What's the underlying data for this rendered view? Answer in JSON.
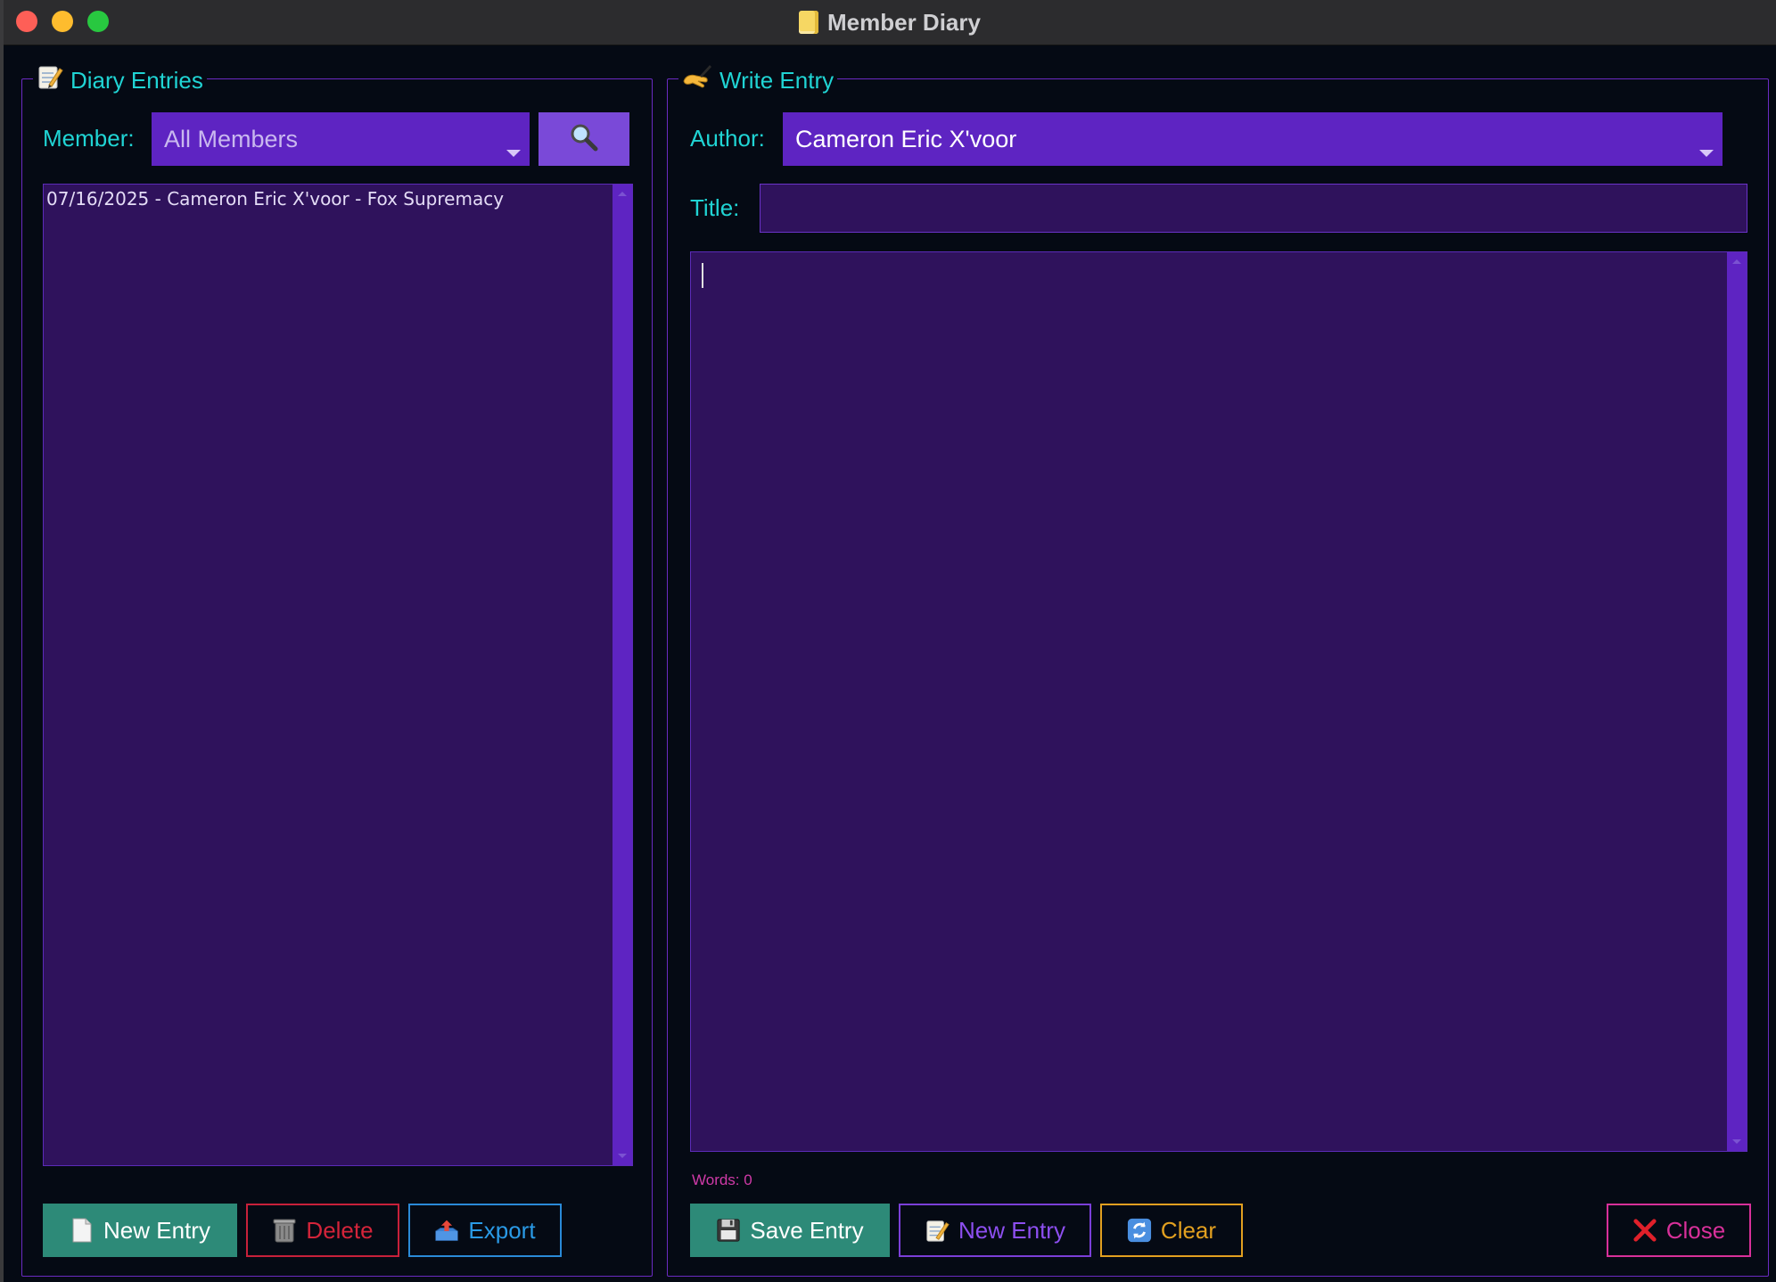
{
  "window": {
    "title": "Member Diary"
  },
  "left_panel": {
    "legend": "Diary Entries",
    "member_label": "Member:",
    "member_combo_value": "All Members",
    "entries": [
      "07/16/2025 - Cameron Eric X'voor - Fox Supremacy"
    ],
    "buttons": {
      "new_entry": "New Entry",
      "delete": "Delete",
      "export": "Export"
    }
  },
  "right_panel": {
    "legend": "Write Entry",
    "author_label": "Author:",
    "author_combo_value": "Cameron Eric X'voor",
    "title_label": "Title:",
    "title_value": "",
    "body_value": "",
    "word_count": "Words: 0",
    "buttons": {
      "save_entry": "Save Entry",
      "new_entry": "New Entry",
      "clear": "Clear",
      "close": "Close"
    }
  },
  "colors": {
    "window_bg": "#050a14",
    "accent_purple": "#5e24c2",
    "text_cyan": "#20d4d4",
    "teal_button": "#2d8a78"
  },
  "icons": [
    "notepad-icon",
    "writing-hand-icon",
    "magnifier-icon",
    "page-icon",
    "trash-icon",
    "outbox-tray-icon",
    "floppy-disk-icon",
    "refresh-icon",
    "cross-mark-icon"
  ]
}
